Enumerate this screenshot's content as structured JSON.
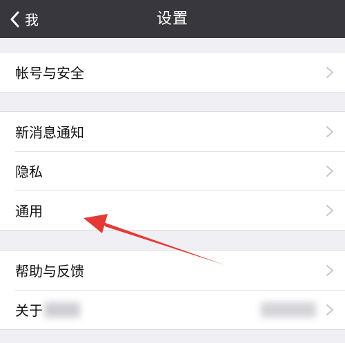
{
  "nav": {
    "back_label": "我",
    "title": "设置"
  },
  "colors": {
    "nav_bg": "#37373d",
    "page_bg": "#efeff4",
    "annotation_arrow": "#e53935"
  },
  "groups": [
    {
      "items": [
        {
          "label": "帐号与安全"
        }
      ]
    },
    {
      "items": [
        {
          "label": "新消息通知"
        },
        {
          "label": "隐私"
        },
        {
          "label": "通用"
        }
      ]
    },
    {
      "items": [
        {
          "label": "帮助与反馈"
        },
        {
          "label": "关于"
        }
      ]
    }
  ],
  "icons": {
    "back": "chevron-left-icon",
    "row": "chevron-right-icon",
    "annotation": "red-arrow-icon"
  }
}
